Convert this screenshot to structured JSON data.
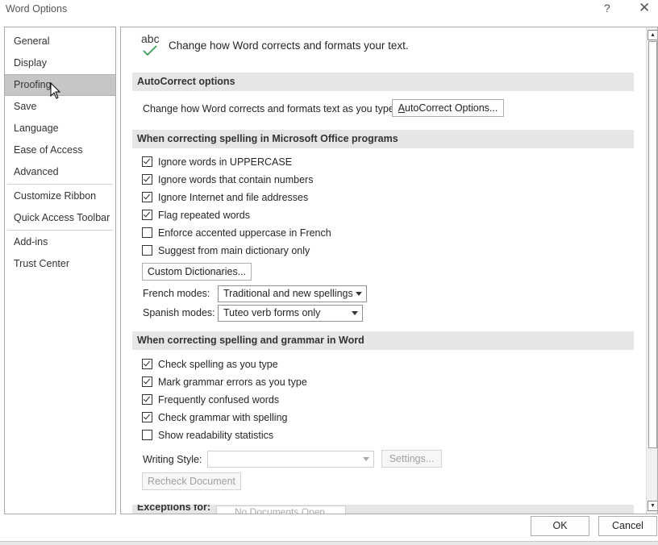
{
  "window": {
    "title": "Word Options",
    "help": "?",
    "close": "✕"
  },
  "sidebar": {
    "items": [
      {
        "label": "General"
      },
      {
        "label": "Display"
      },
      {
        "label": "Proofing",
        "selected": true
      },
      {
        "label": "Save"
      },
      {
        "label": "Language"
      },
      {
        "label": "Ease of Access"
      },
      {
        "label": "Advanced"
      },
      {
        "label": "Customize Ribbon"
      },
      {
        "label": "Quick Access Toolbar"
      },
      {
        "label": "Add-ins"
      },
      {
        "label": "Trust Center"
      }
    ]
  },
  "header": {
    "icon_text": "abc",
    "text": "Change how Word corrects and formats your text."
  },
  "autocorrect": {
    "section_title": "AutoCorrect options",
    "description": "Change how Word corrects and formats text as you type:",
    "button": "AutoCorrect Options..."
  },
  "office_spelling": {
    "section_title": "When correcting spelling in Microsoft Office programs",
    "options": [
      {
        "label": "Ignore words in UPPERCASE",
        "checked": true
      },
      {
        "label": "Ignore words that contain numbers",
        "checked": true
      },
      {
        "label": "Ignore Internet and file addresses",
        "checked": true
      },
      {
        "label": "Flag repeated words",
        "checked": true
      },
      {
        "label": "Enforce accented uppercase in French",
        "checked": false
      },
      {
        "label": "Suggest from main dictionary only",
        "checked": false
      }
    ],
    "custom_dictionaries_button": "Custom Dictionaries...",
    "french_modes_label": "French modes:",
    "french_modes_value": "Traditional and new spellings",
    "spanish_modes_label": "Spanish modes:",
    "spanish_modes_value": "Tuteo verb forms only"
  },
  "word_spelling": {
    "section_title": "When correcting spelling and grammar in Word",
    "options": [
      {
        "label": "Check spelling as you type",
        "checked": true
      },
      {
        "label": "Mark grammar errors as you type",
        "checked": true
      },
      {
        "label": "Frequently confused words",
        "checked": true
      },
      {
        "label": "Check grammar with spelling",
        "checked": true
      },
      {
        "label": "Show readability statistics",
        "checked": false
      }
    ],
    "writing_style_label": "Writing Style:",
    "writing_style_value": "",
    "settings_button": "Settings...",
    "recheck_button": "Recheck Document"
  },
  "exceptions": {
    "label": "Exceptions for:",
    "value": "No Documents Open"
  },
  "footer": {
    "ok": "OK",
    "cancel": "Cancel"
  }
}
